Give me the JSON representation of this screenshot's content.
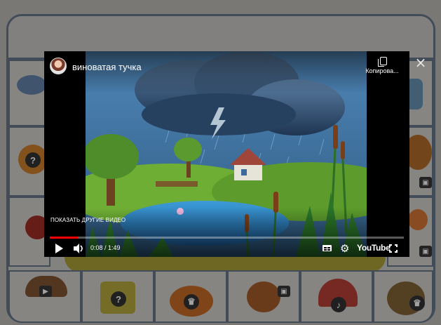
{
  "modal": {
    "close_glyph": "×"
  },
  "video": {
    "title": "виноватая тучка",
    "copy_label": "Копирова...",
    "more_videos_label": "ПОКАЗАТЬ ДРУГИЕ ВИДЕО",
    "time_display": "0:08 / 1:49",
    "progress_fraction": 0.08,
    "logo_text": "YouTube",
    "accent_color": "#ff0000"
  },
  "board": {
    "tile_badges": {
      "question": "?",
      "image": "▣",
      "video": "▶",
      "music": "♪",
      "crown": "♛"
    },
    "frame_color": "#5e6f84"
  },
  "icons": {
    "play": "play-icon",
    "volume": "volume-icon",
    "subtitles": "subtitles-icon",
    "settings": "gear-icon",
    "fullscreen": "fullscreen-icon",
    "copy": "copy-icon",
    "close": "close-icon"
  }
}
